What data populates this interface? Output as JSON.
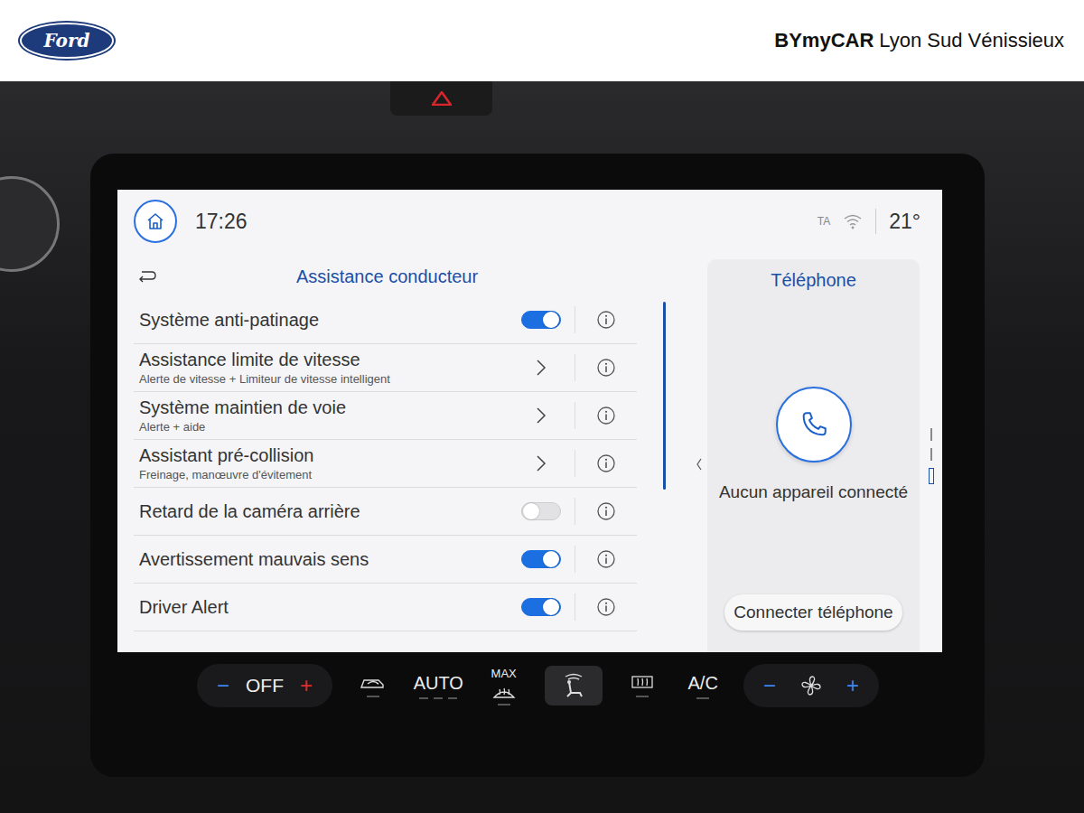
{
  "header": {
    "logo": "Ford",
    "dealer_brand": "BYmyCAR",
    "dealer_location": "Lyon Sud Vénissieux"
  },
  "status_bar": {
    "time": "17:26",
    "ta": "TA",
    "temperature": "21°"
  },
  "panel": {
    "title": "Assistance conducteur"
  },
  "rows": [
    {
      "label": "Système anti-patinage",
      "sublabel": "",
      "kind": "toggle",
      "on": true
    },
    {
      "label": "Assistance limite de vitesse",
      "sublabel": "Alerte de vitesse + Limiteur de vitesse intelligent",
      "kind": "nav"
    },
    {
      "label": "Système maintien de voie",
      "sublabel": "Alerte + aide",
      "kind": "nav"
    },
    {
      "label": "Assistant pré-collision",
      "sublabel": "Freinage, manœuvre d'évitement",
      "kind": "nav"
    },
    {
      "label": "Retard de la caméra arrière",
      "sublabel": "",
      "kind": "toggle",
      "on": false
    },
    {
      "label": "Avertissement mauvais sens",
      "sublabel": "",
      "kind": "toggle",
      "on": true
    },
    {
      "label": "Driver Alert",
      "sublabel": "",
      "kind": "toggle",
      "on": true
    }
  ],
  "phone": {
    "title": "Téléphone",
    "status": "Aucun appareil connecté",
    "button": "Connecter téléphone"
  },
  "climate": {
    "temp_minus": "−",
    "temp_value": "OFF",
    "temp_plus": "+",
    "auto": "AUTO",
    "max": "MAX",
    "ac": "A/C",
    "fan_minus": "−",
    "fan_plus": "+"
  }
}
